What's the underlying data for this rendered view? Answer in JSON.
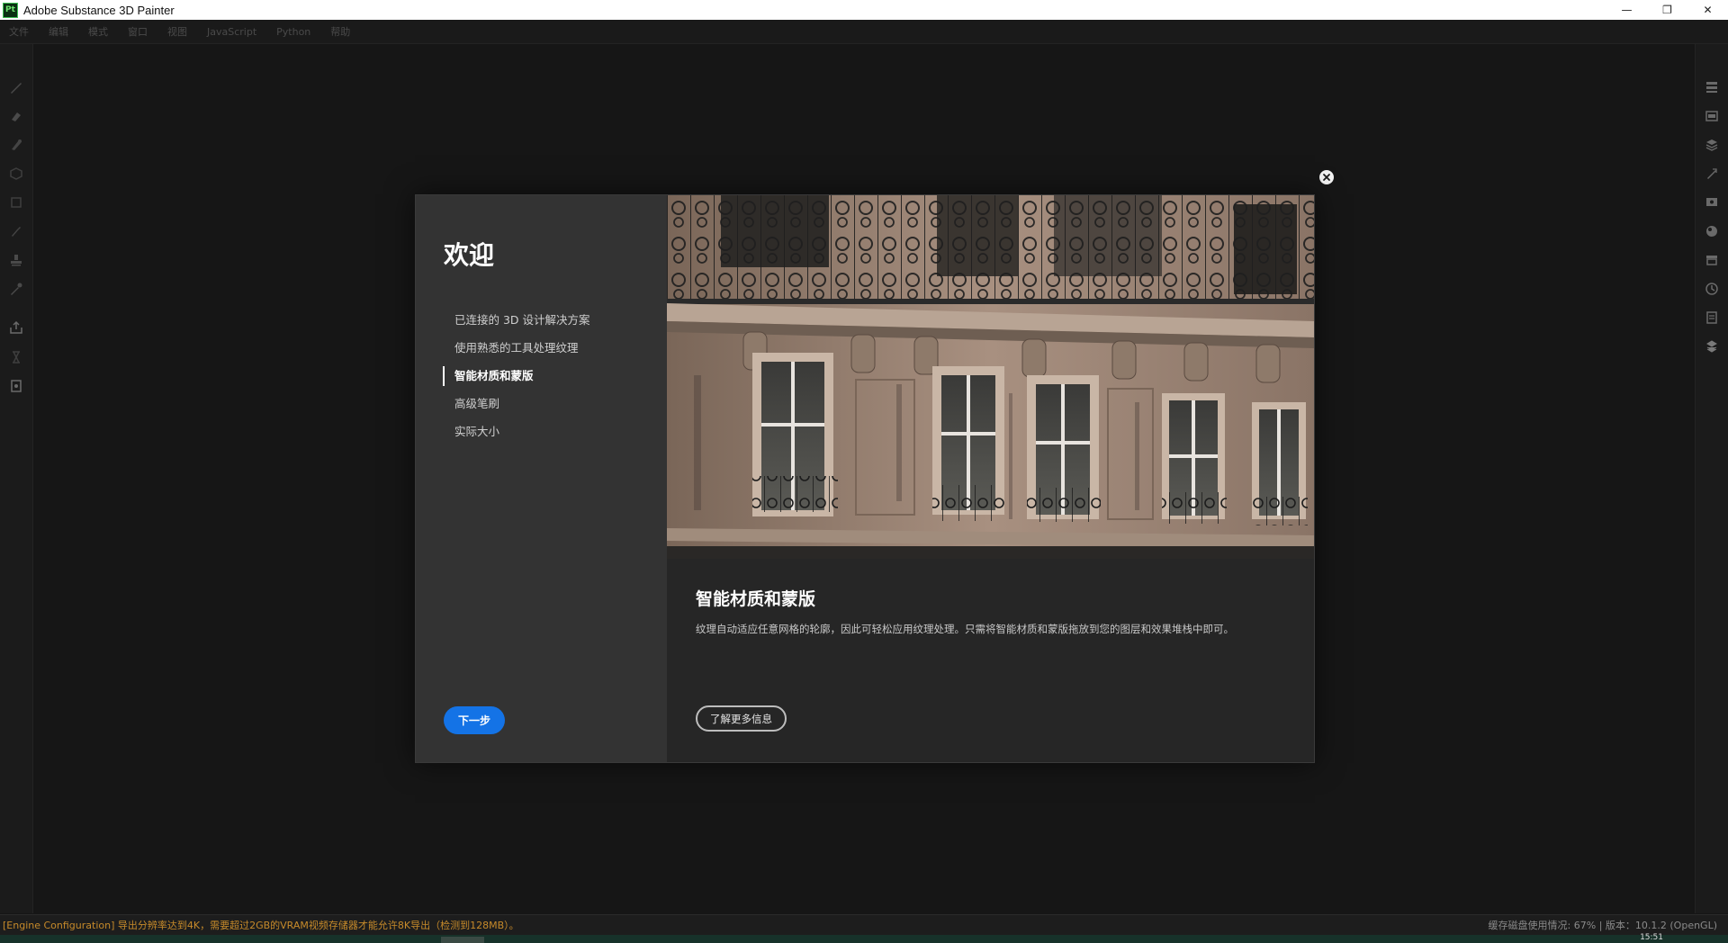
{
  "window": {
    "title": "Adobe Substance 3D Painter",
    "app_icon_text": "Pt",
    "minimize": "—",
    "restore": "❐",
    "close": "✕"
  },
  "menu": [
    "文件",
    "编辑",
    "模式",
    "窗口",
    "视图",
    "JavaScript",
    "Python",
    "帮助"
  ],
  "dialog": {
    "title": "欢迎",
    "nav": [
      {
        "label": "已连接的 3D 设计解决方案",
        "active": false
      },
      {
        "label": "使用熟悉的工具处理纹理",
        "active": false
      },
      {
        "label": "智能材质和蒙版",
        "active": true
      },
      {
        "label": "高级笔刷",
        "active": false
      },
      {
        "label": "实际大小",
        "active": false
      }
    ],
    "next_label": "下一步",
    "content_title": "智能材质和蒙版",
    "content_desc": "纹理自动适应任意网格的轮廓，因此可轻松应用纹理处理。只需将智能材质和蒙版拖放到您的图层和效果堆栈中即可。",
    "learn_more_label": "了解更多信息"
  },
  "status": {
    "message": "[Engine Configuration] 导出分辨率达到4K，需要超过2GB的VRAM视频存储器才能允许8K导出（检测到128MB）。",
    "right": "缓存磁盘使用情况:    67% | 版本：10.1.2 (OpenGL)",
    "clock": "15:51"
  },
  "colors": {
    "accent": "#1473e6",
    "status_warning": "#c68a2a"
  },
  "icons": {
    "left": [
      "paint-brush-icon",
      "eraser-icon",
      "projection-icon",
      "geometry-fill-icon",
      "polygon-fill-icon",
      "smudge-icon",
      "clone-stamp-icon",
      "color-picker-icon",
      "export-icon",
      "bake-icon",
      "document-icon"
    ],
    "right": [
      "texture-set-list-icon",
      "texture-set-settings-icon",
      "layers-icon",
      "properties-icon",
      "display-settings-icon",
      "shader-settings-icon",
      "shelf-icon",
      "history-icon",
      "log-icon",
      "substance-icon"
    ]
  }
}
